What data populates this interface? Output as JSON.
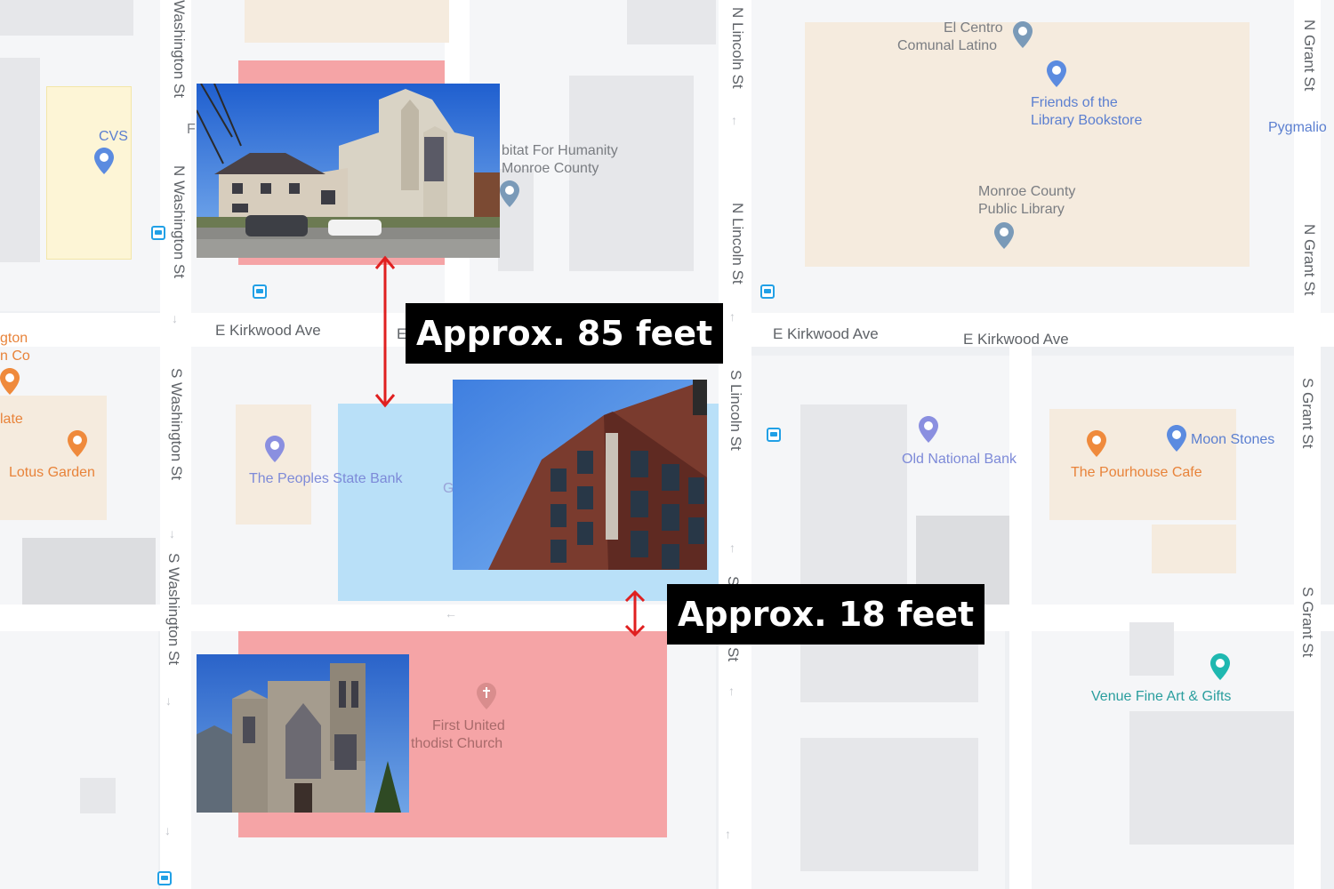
{
  "streets": {
    "e_kirkwood_left": "E Kirkwood Ave",
    "e_kirkwood_mid": "E Kirkwood Ave",
    "e_kirkwood_right": "E Kirkwood Ave",
    "e_kirkwood_cut": "E",
    "washington_top": "Washington St",
    "n_washington": "N Washington St",
    "s_washington_1": "S Washington St",
    "s_washington_2": "S Washington St",
    "n_lincoln_1": "N Lincoln St",
    "n_lincoln_2": "N Lincoln St",
    "s_lincoln": "S Lincoln St",
    "s_lincoln_cut": "S",
    "s_lincoln_cut2": "St",
    "n_grant_1": "N Grant St",
    "n_grant_2": "N Grant St",
    "s_grant_1": "S Grant St",
    "s_grant_2": "S Grant St"
  },
  "places": {
    "cvs": "CVS",
    "el_centro_1": "El Centro",
    "el_centro_2": "Comunal Latino",
    "friends_1": "Friends of the",
    "friends_2": "Library Bookstore",
    "pygmalion": "Pygmalio",
    "library_1": "Monroe County",
    "library_2": "Public Library",
    "habitat_1": "bitat For Humanity",
    "habitat_2": "Monroe County",
    "f_cut": "F",
    "lexington_1": "gton",
    "lexington_2": "n Co",
    "late": "late",
    "lotus": "Lotus Garden",
    "peoples_bank": "The Peoples State Bank",
    "g_cut": "G",
    "old_national": "Old National Bank",
    "pourhouse": "The Pourhouse Cafe",
    "moon_stones": "Moon Stones",
    "venue": "Venue Fine Art & Gifts",
    "church_1": "First United",
    "church_2": "thodist Church"
  },
  "callouts": {
    "top": "Approx. 85 feet",
    "bottom": "Approx. 18 feet"
  },
  "colors": {
    "highlight_red": "#f5a4a6",
    "highlight_blue": "#b9e0f8",
    "arrow_red": "#e02020",
    "callout_bg": "#000000"
  }
}
